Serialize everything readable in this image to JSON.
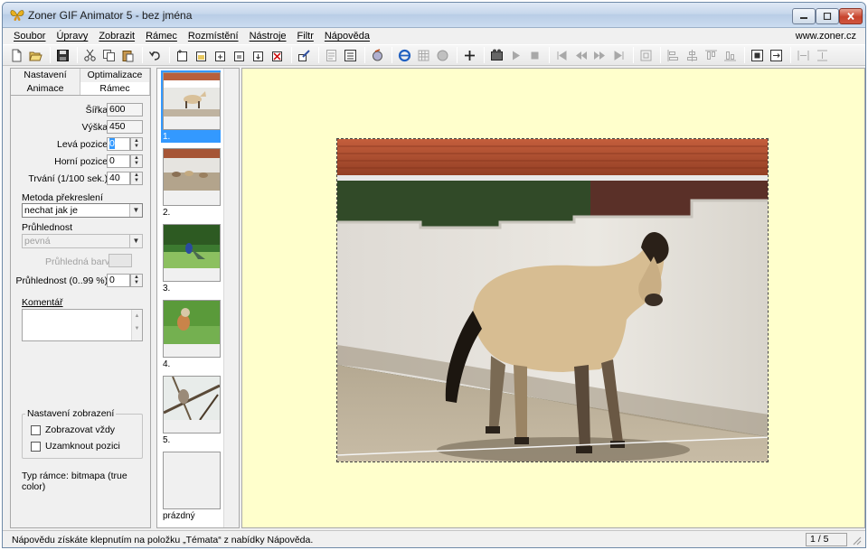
{
  "window": {
    "title": "Zoner GIF Animator 5 - bez jména"
  },
  "menu": [
    "Soubor",
    "Úpravy",
    "Zobrazit",
    "Rámec",
    "Rozmístění",
    "Nástroje",
    "Filtr",
    "Nápověda"
  ],
  "site_link": "www.zoner.cz",
  "toolbar": {
    "icons": [
      "new-icon",
      "open-icon",
      "save-icon",
      "cut-icon",
      "copy-icon",
      "paste-icon",
      "undo-icon",
      "frame-new-icon",
      "frame-open-icon",
      "frame-duplicate-icon",
      "frame-insert-icon",
      "frame-import-icon",
      "frame-delete-icon",
      "edit-frame-icon",
      "properties-icon",
      "tile-icon",
      "optimize-icon",
      "ie-preview-icon",
      "grid-icon",
      "globe-icon",
      "add-icon",
      "animation-wizard-icon",
      "play-icon",
      "stop-icon",
      "first-frame-icon",
      "prev-frame-icon",
      "next-frame-icon",
      "last-frame-icon",
      "fit-icon",
      "align-left-icon",
      "align-center-icon",
      "align-top-icon",
      "align-bottom-icon",
      "size-icon",
      "resize-icon",
      "spread-horizontal-icon",
      "spread-vertical-icon"
    ]
  },
  "left_panel": {
    "tabs_row1": [
      "Nastavení",
      "Optimalizace"
    ],
    "tabs_row2": [
      "Animace",
      "Rámec"
    ],
    "width_label": "Šířka:",
    "width_value": "600",
    "height_label": "Výška:",
    "height_value": "450",
    "left_pos_label": "Levá pozice:",
    "left_pos_value": "0",
    "top_pos_label": "Horní pozice:",
    "top_pos_value": "0",
    "duration_label": "Trvání (1/100 sek.):",
    "duration_value": "40",
    "redraw_label": "Metoda překreslení",
    "redraw_value": "nechat jak je",
    "transparency_label": "Průhlednost",
    "transparency_value": "pevná",
    "transparent_color_label": "Průhledná barva",
    "opacity_label": "Průhlednost (0..99 %):",
    "opacity_value": "0",
    "comment_label": "Komentář",
    "display_group": "Nastavení zobrazení",
    "always_show": "Zobrazovat vždy",
    "lock_position": "Uzamknout pozici",
    "frame_type": "Typ rámce:  bitmapa (true color)"
  },
  "frames": [
    {
      "label": "1."
    },
    {
      "label": "2."
    },
    {
      "label": "3."
    },
    {
      "label": "4."
    },
    {
      "label": "5."
    },
    {
      "label": "prázdný"
    }
  ],
  "status": {
    "text": "Nápovědu získáte klepnutím na položku „Témata“ z nabídky Nápověda.",
    "counter": "1 / 5"
  }
}
